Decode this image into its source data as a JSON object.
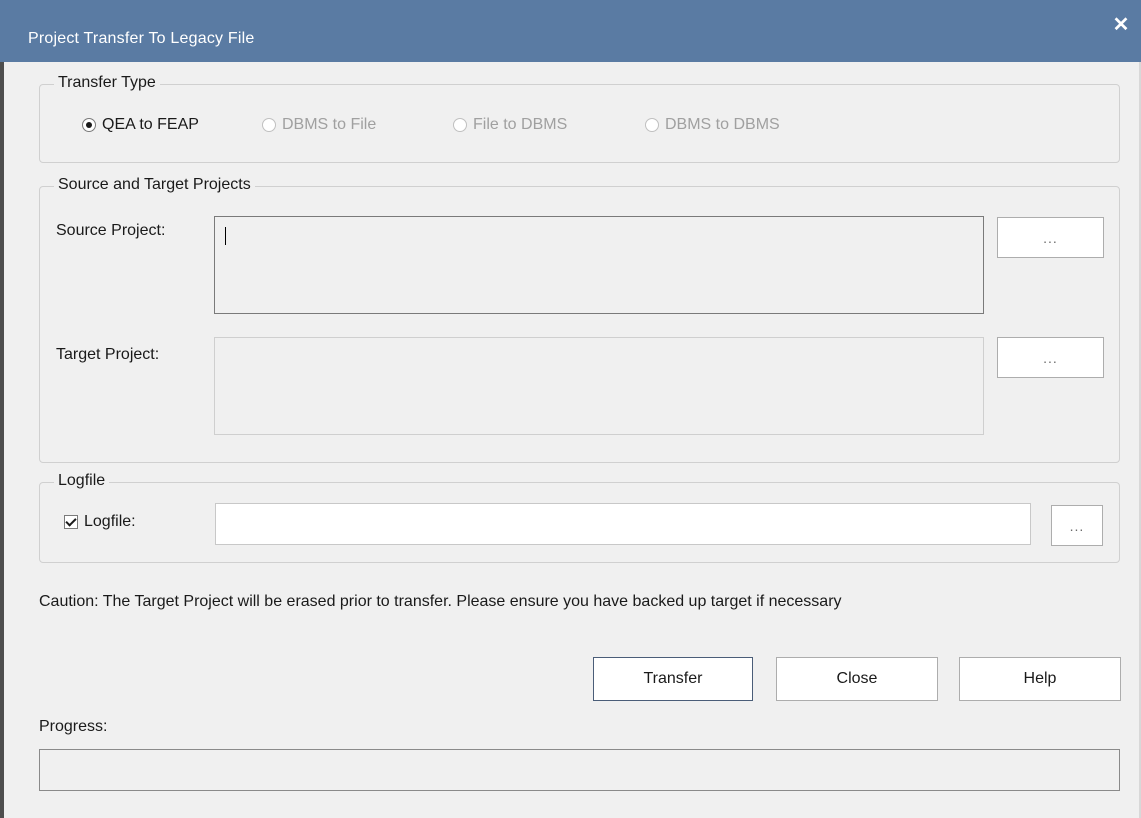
{
  "window": {
    "title": "Project Transfer To Legacy File",
    "close_glyph": "✕",
    "titlebar_color": "#5a7ba3"
  },
  "transfer_type": {
    "legend": "Transfer Type",
    "options": [
      {
        "label": "QEA to FEAP",
        "checked": true,
        "enabled": true
      },
      {
        "label": "DBMS to File",
        "checked": false,
        "enabled": false
      },
      {
        "label": "File to DBMS",
        "checked": false,
        "enabled": false
      },
      {
        "label": "DBMS to DBMS",
        "checked": false,
        "enabled": false
      }
    ]
  },
  "projects": {
    "legend": "Source and Target Projects",
    "source_label": "Source Project:",
    "source_value": "",
    "source_browse": "...",
    "target_label": "Target Project:",
    "target_value": "",
    "target_browse": "..."
  },
  "logfile": {
    "legend": "Logfile",
    "checkbox_label": "Logfile:",
    "checked": true,
    "value": "",
    "browse": "..."
  },
  "caution": "Caution: The Target Project will be erased prior to transfer. Please ensure you have backed up target if necessary",
  "buttons": {
    "transfer": "Transfer",
    "close": "Close",
    "help": "Help"
  },
  "progress": {
    "label": "Progress:",
    "value": 0
  }
}
